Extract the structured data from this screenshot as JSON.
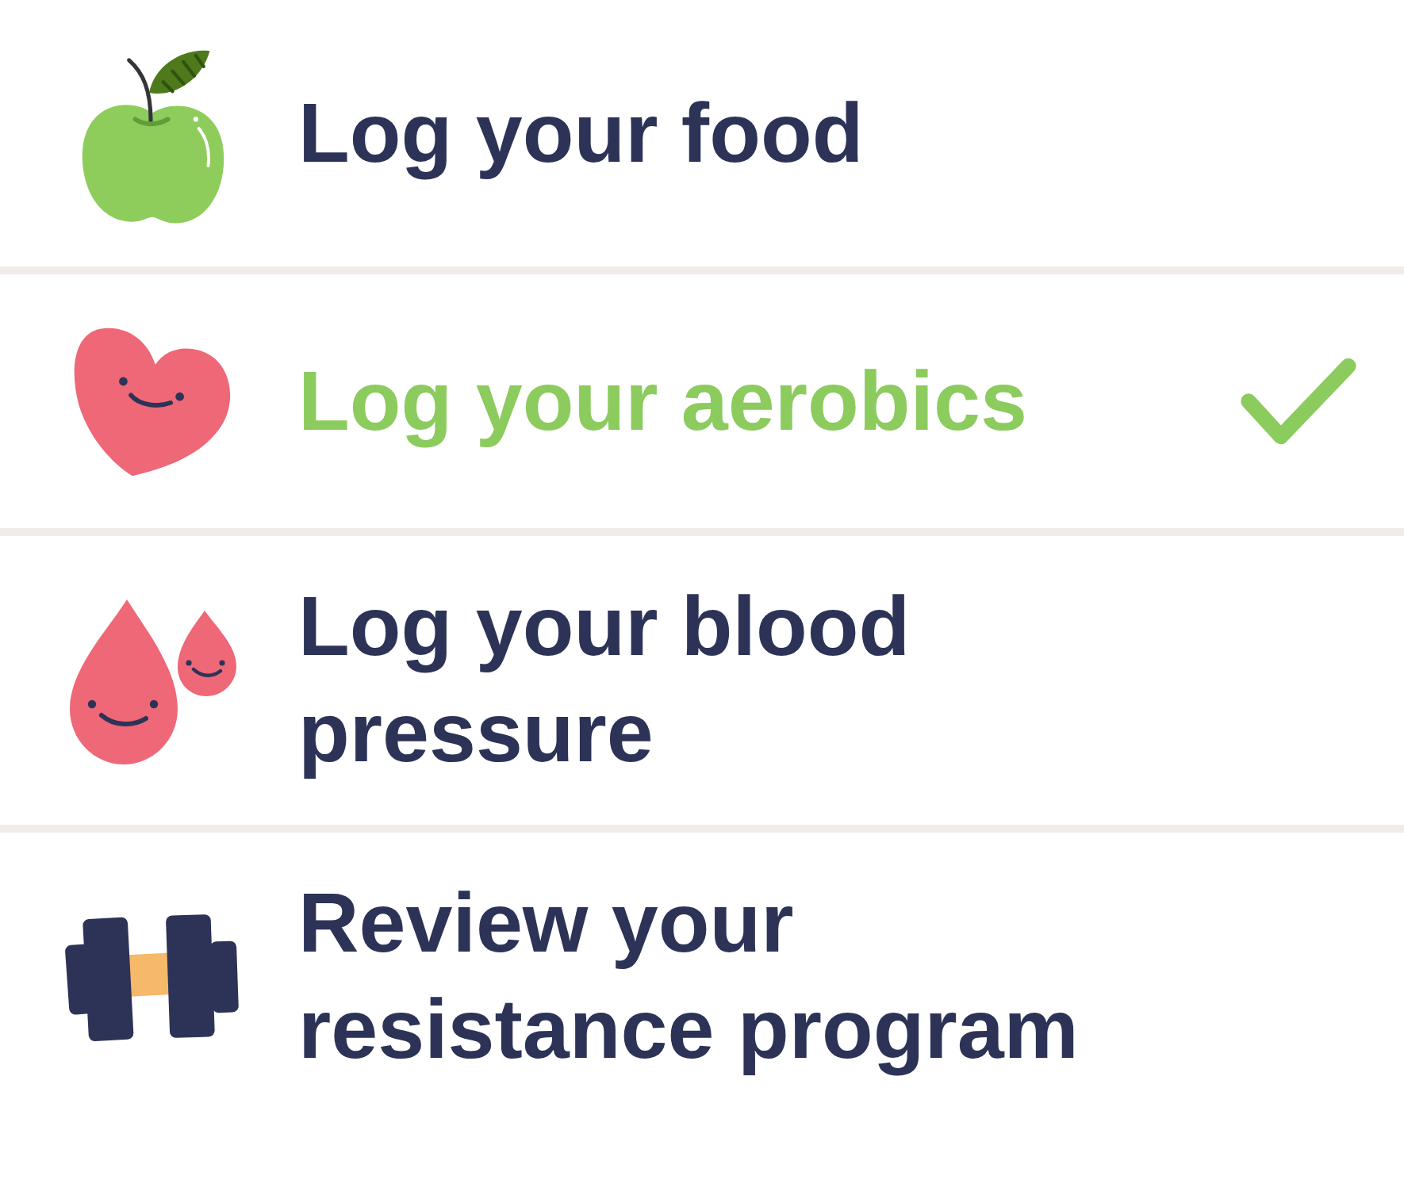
{
  "tasks": [
    {
      "kind": "apple",
      "label": "Log your food",
      "checked": false
    },
    {
      "kind": "heart",
      "label": "Log your aerobics",
      "checked": true
    },
    {
      "kind": "drops",
      "label": "Log your blood pressure",
      "checked": false
    },
    {
      "kind": "dumbbell",
      "label": "Review your resistance program",
      "checked": false
    }
  ]
}
